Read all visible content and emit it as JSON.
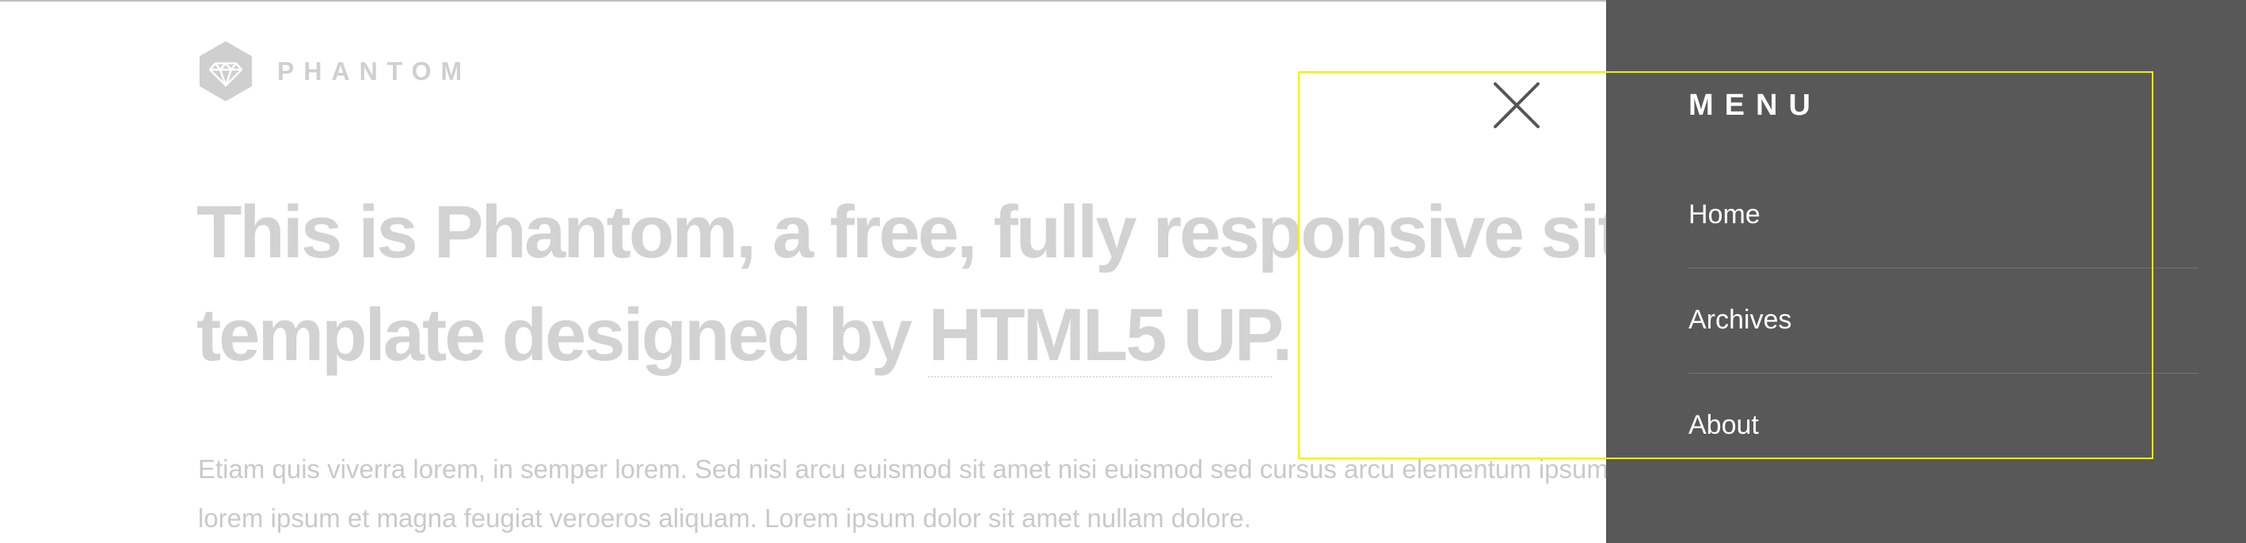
{
  "site": {
    "name": "PHANTOM",
    "logo_icon": "diamond-hexagon-icon"
  },
  "hero": {
    "headline_line1": "This is Phantom, a free, fully responsive site",
    "headline_line2_prefix": "template designed by ",
    "headline_link": "HTML5 UP",
    "headline_line2_suffix": ".",
    "intro_line1": "Etiam quis viverra lorem, in semper lorem. Sed nisl arcu euismod sit amet nisi euismod sed cursus arcu elementum ipsum",
    "intro_line2": "lorem ipsum et magna feugiat veroeros aliquam. Lorem ipsum dolor sit amet nullam dolore."
  },
  "menu": {
    "title": "MENU",
    "close_icon": "close-icon",
    "items": [
      {
        "label": "Home"
      },
      {
        "label": "Archives"
      },
      {
        "label": "About"
      }
    ]
  },
  "colors": {
    "menu_background": "#585858",
    "focus_outline": "#f2f200",
    "dimmed_text": "#d2d2d2"
  }
}
